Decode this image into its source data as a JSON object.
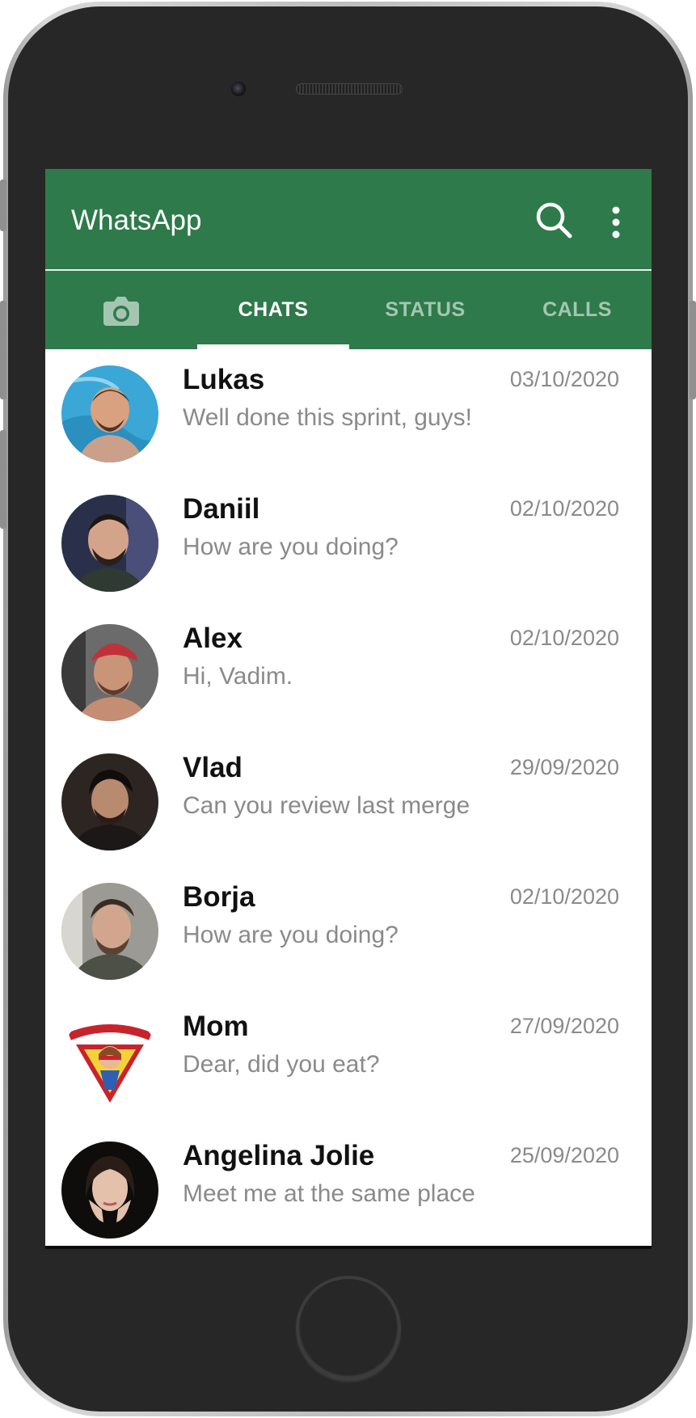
{
  "header": {
    "title": "WhatsApp",
    "icons": [
      "search-icon",
      "more-vert-icon"
    ]
  },
  "tabs": [
    {
      "label": "",
      "icon": "camera-icon",
      "active": false
    },
    {
      "label": "CHATS",
      "active": true
    },
    {
      "label": "STATUS",
      "active": false
    },
    {
      "label": "CALLS",
      "active": false
    }
  ],
  "colors": {
    "primary": "#2e7a4a",
    "tab_inactive": "#a4c6b1",
    "text_secondary": "#8a8a8a"
  },
  "chats": [
    {
      "name": "Lukas",
      "message": "Well done this sprint, guys!",
      "date": "03/10/2020"
    },
    {
      "name": "Daniil",
      "message": "How are you doing?",
      "date": "02/10/2020"
    },
    {
      "name": "Alex",
      "message": "Hi, Vadim.",
      "date": "02/10/2020"
    },
    {
      "name": "Vlad",
      "message": "Can you review last merge",
      "date": "29/09/2020"
    },
    {
      "name": "Borja",
      "message": "How are you doing?",
      "date": "02/10/2020"
    },
    {
      "name": "Mom",
      "message": "Dear, did you eat?",
      "date": "27/09/2020"
    },
    {
      "name": "Angelina Jolie",
      "message": "Meet me at the same place",
      "date": "25/09/2020"
    }
  ]
}
